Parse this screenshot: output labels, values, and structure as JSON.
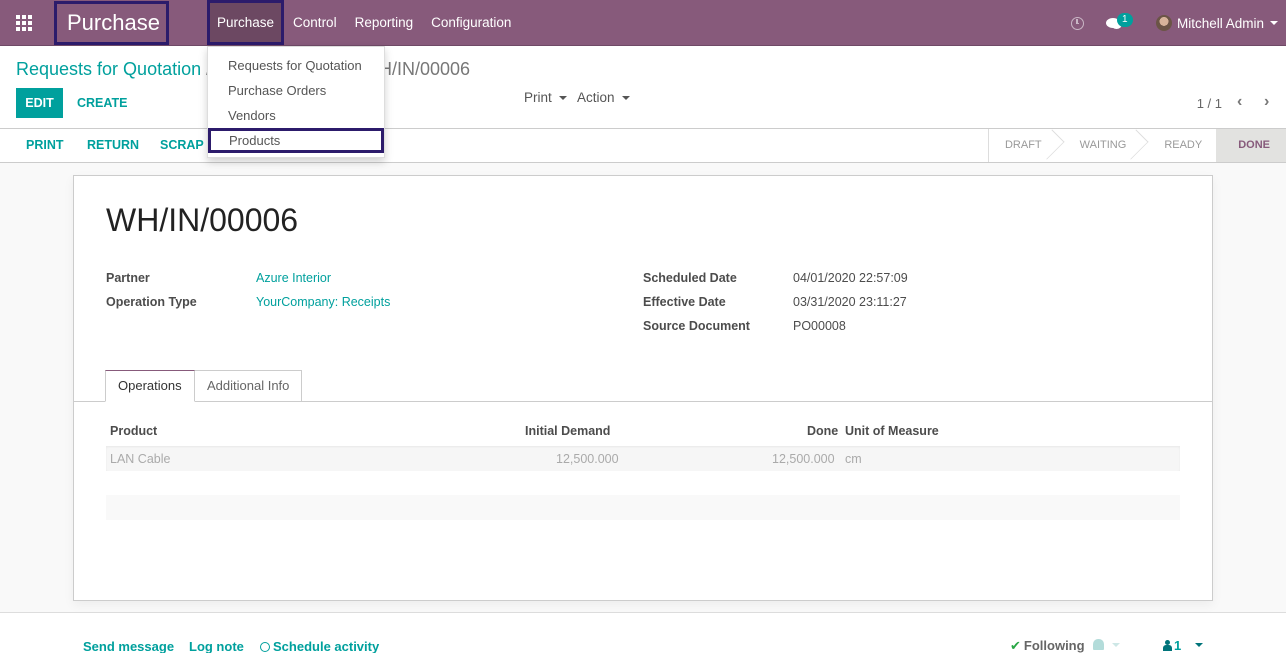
{
  "navbar": {
    "app_name": "Purchase",
    "menu": [
      "Purchase",
      "Control",
      "Reporting",
      "Configuration"
    ],
    "active_menu": "Purchase",
    "messages_count": "1",
    "user_name": "Mitchell Admin",
    "brand_color": "#875a7b",
    "highlight_color": "#2c1b6b"
  },
  "purchase_dropdown": {
    "items": [
      "Requests for Quotation",
      "Purchase Orders",
      "Vendors",
      "Products"
    ],
    "highlighted": "Products"
  },
  "control_panel": {
    "breadcrumb_parent": "Requests for Quotation",
    "breadcrumb_separator": "/",
    "breadcrumb_current": "WH/IN/00006",
    "edit_label": "EDIT",
    "create_label": "CREATE",
    "print_label": "Print",
    "action_label": "Action",
    "pager": "1 / 1"
  },
  "statusbar": {
    "buttons": [
      "PRINT",
      "RETURN",
      "SCRAP"
    ],
    "stages": [
      "DRAFT",
      "WAITING",
      "READY",
      "DONE"
    ],
    "current_stage": "DONE"
  },
  "record": {
    "title": "WH/IN/00006",
    "fields_left": [
      {
        "label": "Partner",
        "value": "Azure Interior"
      },
      {
        "label": "Operation Type",
        "value": "YourCompany: Receipts"
      }
    ],
    "fields_right": [
      {
        "label": "Scheduled Date",
        "value": "04/01/2020 22:57:09"
      },
      {
        "label": "Effective Date",
        "value": "03/31/2020 23:11:27"
      },
      {
        "label": "Source Document",
        "value": "PO00008"
      }
    ],
    "tabs": [
      "Operations",
      "Additional Info"
    ],
    "active_tab": "Operations",
    "operations": {
      "columns": [
        "Product",
        "Initial Demand",
        "Done",
        "Unit of Measure"
      ],
      "rows": [
        {
          "product": "LAN Cable",
          "initial_demand": "12,500.000",
          "done": "12,500.000",
          "uom": "cm"
        }
      ]
    }
  },
  "chatter": {
    "send_message": "Send message",
    "log_note": "Log note",
    "schedule_activity": "Schedule activity",
    "following": "Following",
    "followers_count": "1"
  }
}
